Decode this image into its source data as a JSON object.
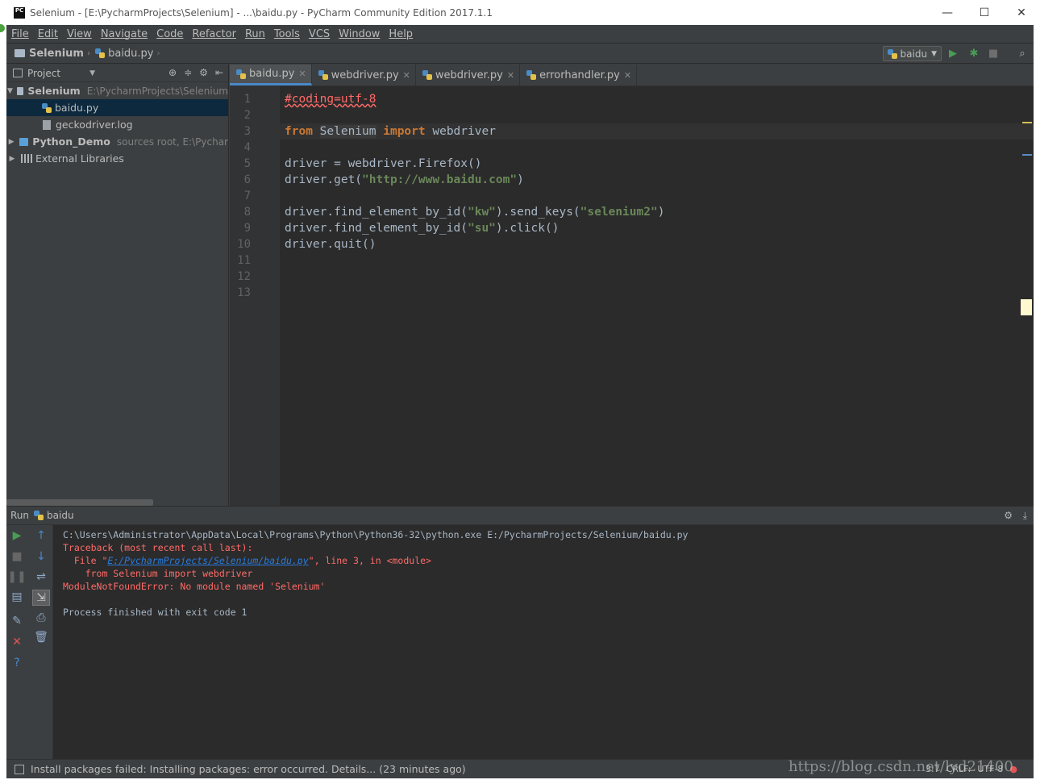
{
  "window": {
    "title": "Selenium - [E:\\PycharmProjects\\Selenium] - ...\\baidu.py - PyCharm Community Edition 2017.1.1",
    "app_icon_text": "PC",
    "minimize": "—",
    "maximize": "☐",
    "close": "✕"
  },
  "menu": [
    "File",
    "Edit",
    "View",
    "Navigate",
    "Code",
    "Refactor",
    "Run",
    "Tools",
    "VCS",
    "Window",
    "Help"
  ],
  "navbar": {
    "crumbs": [
      "Selenium",
      "baidu.py"
    ],
    "run_config": "baidu"
  },
  "project": {
    "header": "Project",
    "tree": [
      {
        "label": "Selenium",
        "hint": "E:\\PycharmProjects\\Selenium"
      },
      {
        "label": "baidu.py",
        "hint": ""
      },
      {
        "label": "geckodriver.log",
        "hint": ""
      },
      {
        "label": "Python_Demo",
        "hint": "sources root,  E:\\Pychar"
      },
      {
        "label": "External Libraries",
        "hint": ""
      }
    ]
  },
  "editor": {
    "tabs": [
      {
        "label": "baidu.py",
        "active": true
      },
      {
        "label": "webdriver.py",
        "active": false
      },
      {
        "label": "webdriver.py",
        "active": false
      },
      {
        "label": "errorhandler.py",
        "active": false
      }
    ],
    "line_numbers": [
      "1",
      "2",
      "3",
      "4",
      "5",
      "6",
      "7",
      "8",
      "9",
      "10",
      "11",
      "12",
      "13"
    ],
    "code": {
      "l1": "#coding=utf-8",
      "l3_from": "from",
      "l3_mod": "Selenium",
      "l3_import": "import",
      "l3_rest": " webdriver",
      "l5": "driver = webdriver.Firefox()",
      "l6_a": "driver.get(",
      "l6_s": "\"http://www.baidu.com\"",
      "l6_b": ")",
      "l8_a": "driver.find_element_by_id(",
      "l8_s1": "\"kw\"",
      "l8_b": ").send_keys(",
      "l8_s2": "\"selenium2\"",
      "l8_c": ")",
      "l9_a": "driver.find_element_by_id(",
      "l9_s": "\"su\"",
      "l9_b": ").click()",
      "l10": "driver.quit()"
    }
  },
  "run": {
    "title": "Run",
    "config": "baidu",
    "console": {
      "cmd": "C:\\Users\\Administrator\\AppData\\Local\\Programs\\Python\\Python36-32\\python.exe E:/PycharmProjects/Selenium/baidu.py",
      "tb1": "Traceback (most recent call last):",
      "tb2_a": "  File \"",
      "tb2_link": "E:/PycharmProjects/Selenium/baidu.py",
      "tb2_b": "\", line 3, in <module>",
      "tb3": "    from Selenium import webdriver",
      "tb4": "ModuleNotFoundError: No module named 'Selenium'",
      "finish": "Process finished with exit code 1"
    }
  },
  "status": {
    "message": "Install packages failed: Installing packages: error occurred. Details... (23 minutes ago)",
    "position": "3:7",
    "line_sep": "CRLF:",
    "encoding": "UTF-8",
    "watermark": "https://blog.csdn.net/lyd21400"
  },
  "colors": {
    "background": "#2b2b2b",
    "panel": "#3c3f41",
    "keyword": "#cc7832",
    "string": "#6a8759",
    "error": "#ff6b68",
    "link": "#287bde",
    "run_green": "#499c54"
  }
}
